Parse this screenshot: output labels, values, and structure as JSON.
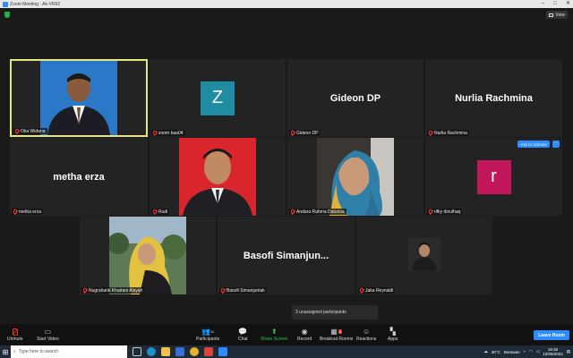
{
  "window": {
    "title": "Zoom Meeting - Ak-VR62",
    "view_label": "View"
  },
  "participants": [
    {
      "name": "Oka Widana",
      "type": "photo",
      "active": true
    },
    {
      "name": "zoom baa04",
      "type": "avatar",
      "initial": "Z",
      "color": "#1f8ca3"
    },
    {
      "name": "Gideon DP",
      "type": "text",
      "display": "Gideon DP"
    },
    {
      "name": "Nurlia Rachmina",
      "type": "text",
      "display": "Nurlia Rachmina"
    },
    {
      "name": "metha erza",
      "type": "text",
      "display": "metha erza"
    },
    {
      "name": "Rudi",
      "type": "photo"
    },
    {
      "name": "Andara Rahma Daturisa",
      "type": "photo"
    },
    {
      "name": "rifky dinulhaq",
      "type": "avatar",
      "initial": "r",
      "color": "#c2185b"
    },
    {
      "name": "Nugrahanti Khairani Aisyah",
      "type": "photo"
    },
    {
      "name": "Basofi Simanjuntak",
      "type": "text",
      "display": "Basofi  Simanjun..."
    },
    {
      "name": "Jaka Reynaldi",
      "type": "photo"
    }
  ],
  "ask_to_unmute": "Ask to Unmute",
  "unassigned": "3 unassigned participants",
  "toolbar": {
    "unmute": "Unmute",
    "start_video": "Start Video",
    "participants": "Participants",
    "participants_count": "11",
    "chat": "Chat",
    "share_screen": "Share Screen",
    "record": "Record",
    "breakout_rooms": "Breakout Rooms",
    "breakout_badge": "3",
    "reactions": "Reactions",
    "apps": "Apps",
    "leave": "Leave Room"
  },
  "taskbar": {
    "search_placeholder": "Type here to search",
    "temp": "30°C",
    "weather": "Berawan",
    "time": "18:36",
    "date": "10/05/2022"
  },
  "colors": {
    "accent": "#2d8cff",
    "active_border": "#e8e67a",
    "share_green": "#30c35b"
  }
}
